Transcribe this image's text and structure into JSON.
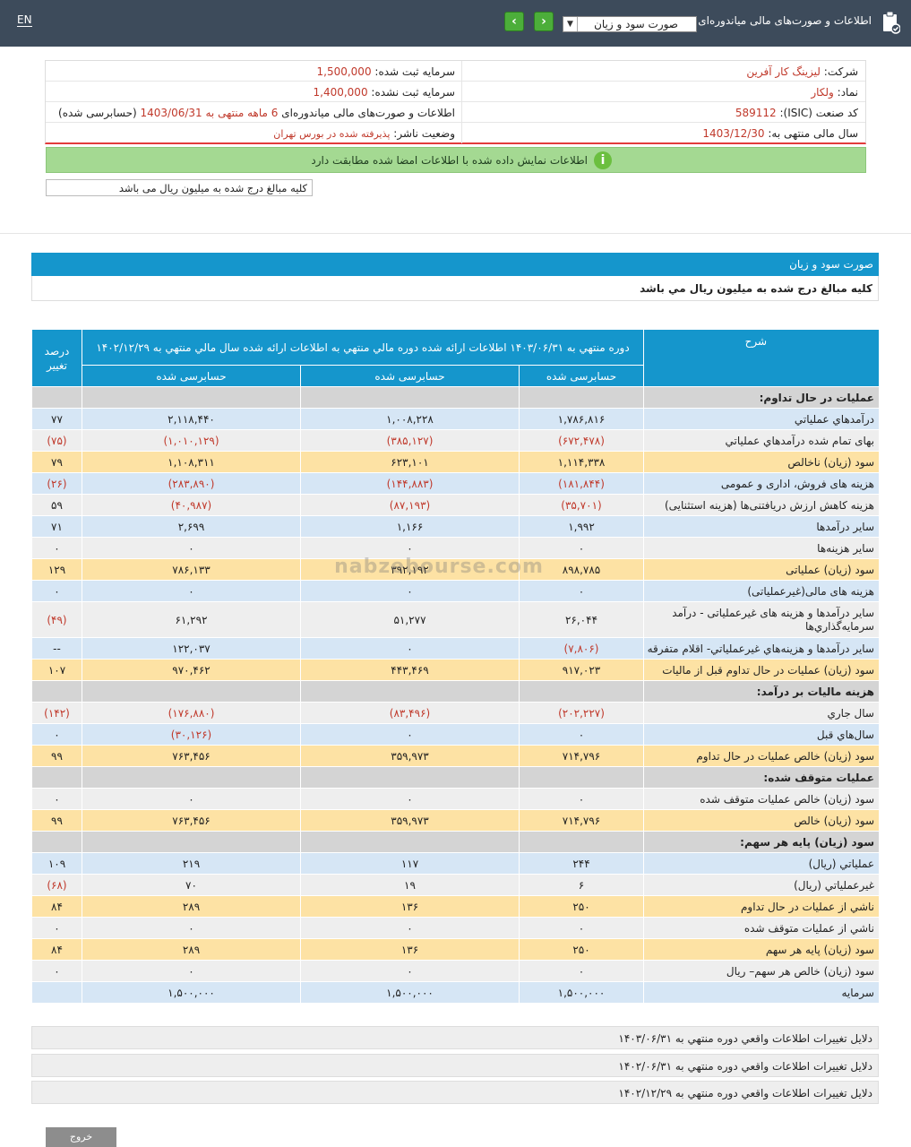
{
  "topbar": {
    "lang": "EN",
    "title": "اطلاعات و صورت‌های مالی میاندوره‌ای",
    "selected": "صورت سود و زيان",
    "prev_icon": "chevron-left-icon",
    "next_icon": "chevron-right-icon"
  },
  "info": {
    "company_label": "شرکت:",
    "company_value": "ليزينگ كار آفرين",
    "symbol_label": "نماد:",
    "symbol_value": "ولكار",
    "isic_label": "کد صنعت (ISIC):",
    "isic_value": "589112",
    "fiscal_label": "سال مالی منتهی به:",
    "fiscal_value": "1403/12/30",
    "reg_capital_label": "سرمایه ثبت شده:",
    "reg_capital_value": "1,500,000",
    "unreg_capital_label": "سرمایه ثبت نشده:",
    "unreg_capital_value": "1,400,000",
    "period_text_a": "اطلاعات و صورت‌های مالی میاندوره‌ای",
    "period_months": "6 ماهه منتهی به",
    "period_date": "1403/06/31",
    "period_status": "(حسابرسی شده)",
    "publisher_label": "وضعیت ناشر:",
    "publisher_value": "پذیرفته شده در بورس تهران",
    "match_message": "اطلاعات نمایش داده شده با اطلاعات امضا شده مطابقت دارد",
    "note": "کلیه مبالغ درج شده به میلیون ریال می باشد"
  },
  "section": {
    "title": "صورت سود و زيان",
    "subtitle": "كليه مبالغ درج شده به ميليون ريال مي باشد"
  },
  "table": {
    "col_desc": "شرح",
    "col_p1": "دوره منتهي به ۱۴۰۳/۰۶/۳۱",
    "col_p2": "اطلاعات واقعي دوره منتهي به ۱۴۰۲/۰۶/۳۱",
    "col_p2_extra": "اطلاعات ارائه شده دوره مالي منتهي به",
    "col_p3": "اطلاعات ارائه شده سال مالي منتهي به ۱۴۰۲/۱۲/۲۹",
    "col_pct": "درصد تغيير",
    "audit1": "حسابرسی شده",
    "audit2": "حسابرسی شده",
    "audit3": "حسابرسی شده",
    "rows": [
      {
        "type": "section",
        "desc": "عمليات در حال تداوم:",
        "a": "",
        "b": "",
        "c": "",
        "d": ""
      },
      {
        "type": "blue",
        "desc": "درآمدهاي عملياتي",
        "a": "۱,۷۸۶,۸۱۶",
        "b": "۱,۰۰۸,۲۲۸",
        "c": "۲,۱۱۸,۴۴۰",
        "d": "۷۷"
      },
      {
        "type": "gray",
        "desc": "بهاى تمام شده درآمدهاي عملياتي",
        "a": "(۶۷۲,۴۷۸)",
        "b": "(۳۸۵,۱۲۷)",
        "c": "(۱,۰۱۰,۱۲۹)",
        "d": "(۷۵)"
      },
      {
        "type": "orange",
        "desc": "سود (زيان) ناخالص",
        "a": "۱,۱۱۴,۳۳۸",
        "b": "۶۲۳,۱۰۱",
        "c": "۱,۱۰۸,۳۱۱",
        "d": "۷۹"
      },
      {
        "type": "blue",
        "desc": "هزينه هاى فروش، ادارى و عمومى",
        "a": "(۱۸۱,۸۴۴)",
        "b": "(۱۴۴,۸۸۳)",
        "c": "(۲۸۳,۸۹۰)",
        "d": "(۲۶)"
      },
      {
        "type": "gray",
        "desc": "هزینه کاهش ارزش دریافتنی‌ها (هزینه استثنایی)",
        "a": "(۳۵,۷۰۱)",
        "b": "(۸۷,۱۹۳)",
        "c": "(۴۰,۹۸۷)",
        "d": "۵۹"
      },
      {
        "type": "blue",
        "desc": "ساير درآمدها",
        "a": "۱,۹۹۲",
        "b": "۱,۱۶۶",
        "c": "۲,۶۹۹",
        "d": "۷۱"
      },
      {
        "type": "gray",
        "desc": "سایر هزینه‌ها",
        "a": "۰",
        "b": "۰",
        "c": "۰",
        "d": "۰"
      },
      {
        "type": "orange",
        "desc": "سود (زيان) عملياتى",
        "a": "۸۹۸,۷۸۵",
        "b": "۳۹۲,۱۹۲",
        "c": "۷۸۶,۱۳۳",
        "d": "۱۲۹"
      },
      {
        "type": "blue",
        "desc": "هزينه هاى مالى(غيرعملياتى)",
        "a": "۰",
        "b": "۰",
        "c": "۰",
        "d": "۰"
      },
      {
        "type": "gray",
        "tall": true,
        "desc": "ساير درآمدها و هزينه هاى غيرعملياتى - درآمد سرمايه‌گذاري‌ها",
        "a": "۲۶,۰۴۴",
        "b": "۵۱,۲۷۷",
        "c": "۶۱,۲۹۲",
        "d": "(۴۹)"
      },
      {
        "type": "blue",
        "desc": "ساير درآمدها و هزينه‌هاي غيرعملياتي- اقلام متفرقه",
        "a": "(۷,۸۰۶)",
        "b": "۰",
        "c": "۱۲۲,۰۳۷",
        "d": "--"
      },
      {
        "type": "orange",
        "desc": "سود (زيان) عمليات در حال تداوم قبل از ماليات",
        "a": "۹۱۷,۰۲۳",
        "b": "۴۴۳,۴۶۹",
        "c": "۹۷۰,۴۶۲",
        "d": "۱۰۷"
      },
      {
        "type": "section",
        "desc": "هزينه ماليات بر درآمد:",
        "a": "",
        "b": "",
        "c": "",
        "d": ""
      },
      {
        "type": "gray",
        "desc": "سال جاري",
        "a": "(۲۰۲,۲۲۷)",
        "b": "(۸۳,۴۹۶)",
        "c": "(۱۷۶,۸۸۰)",
        "d": "(۱۴۲)"
      },
      {
        "type": "blue",
        "desc": "سال‌هاي قبل",
        "a": "۰",
        "b": "۰",
        "c": "(۳۰,۱۲۶)",
        "d": "۰"
      },
      {
        "type": "orange",
        "desc": "سود (زيان) خالص عمليات در حال تداوم",
        "a": "۷۱۴,۷۹۶",
        "b": "۳۵۹,۹۷۳",
        "c": "۷۶۳,۴۵۶",
        "d": "۹۹"
      },
      {
        "type": "section",
        "desc": "عمليات متوقف شده:",
        "a": "",
        "b": "",
        "c": "",
        "d": ""
      },
      {
        "type": "gray",
        "desc": "سود (زيان) خالص عمليات متوقف شده",
        "a": "۰",
        "b": "۰",
        "c": "۰",
        "d": "۰"
      },
      {
        "type": "orange",
        "desc": "سود (زيان) خالص",
        "a": "۷۱۴,۷۹۶",
        "b": "۳۵۹,۹۷۳",
        "c": "۷۶۳,۴۵۶",
        "d": "۹۹"
      },
      {
        "type": "section",
        "desc": "سود (زيان) پايه هر سهم:",
        "a": "",
        "b": "",
        "c": "",
        "d": ""
      },
      {
        "type": "blue",
        "desc": "عملياتي (ريال)",
        "a": "۲۴۴",
        "b": "۱۱۷",
        "c": "۲۱۹",
        "d": "۱۰۹"
      },
      {
        "type": "gray",
        "desc": "غيرعملياتي (ريال)",
        "a": "۶",
        "b": "۱۹",
        "c": "۷۰",
        "d": "(۶۸)"
      },
      {
        "type": "orange",
        "desc": "ناشي از عمليات در حال تداوم",
        "a": "۲۵۰",
        "b": "۱۳۶",
        "c": "۲۸۹",
        "d": "۸۴"
      },
      {
        "type": "gray",
        "desc": "ناشي از عمليات متوقف شده",
        "a": "۰",
        "b": "۰",
        "c": "۰",
        "d": "۰"
      },
      {
        "type": "orange",
        "desc": "سود (زيان) پايه هر سهم",
        "a": "۲۵۰",
        "b": "۱۳۶",
        "c": "۲۸۹",
        "d": "۸۴"
      },
      {
        "type": "gray",
        "desc": "سود (زيان) خالص هر سهم– ريال",
        "a": "۰",
        "b": "۰",
        "c": "۰",
        "d": "۰"
      },
      {
        "type": "blue",
        "desc": "سرمايه",
        "a": "۱,۵۰۰,۰۰۰",
        "b": "۱,۵۰۰,۰۰۰",
        "c": "۱,۵۰۰,۰۰۰",
        "d": ""
      }
    ]
  },
  "links": [
    "دلايل تغييرات اطلاعات واقعي دوره منتهي به ۱۴۰۳/۰۶/۳۱",
    "دلايل تغييرات اطلاعات واقعي دوره منتهي به ۱۴۰۲/۰۶/۳۱",
    "دلايل تغييرات اطلاعات واقعي دوره منتهي به ۱۴۰۲/۱۲/۲۹"
  ],
  "exit_label": "خروج",
  "watermark": "nabzebourse.com",
  "colors": {
    "topbar": "#3d4b5b",
    "header": "#1596cc",
    "green": "#4cae3a",
    "negative": "#c0392b",
    "row_blue": "#d6e6f5",
    "row_orange": "#fde2a4"
  }
}
